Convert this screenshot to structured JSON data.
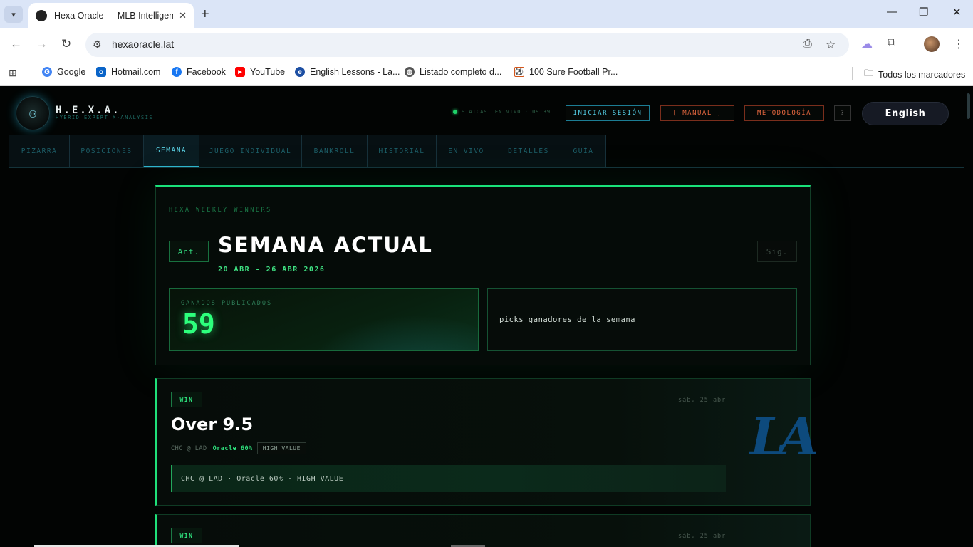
{
  "browser": {
    "tab_title": "Hexa Oracle — MLB Intelligence",
    "url": "hexaoracle.lat",
    "bookmarks": [
      {
        "label": "Google",
        "color": "#4285f4",
        "glyph": "G"
      },
      {
        "label": "Hotmail.com",
        "color": "#0a64c8",
        "glyph": "o"
      },
      {
        "label": "Facebook",
        "color": "#1877f2",
        "glyph": "f"
      },
      {
        "label": "YouTube",
        "color": "#ff0000",
        "glyph": "▶"
      },
      {
        "label": "English Lessons - La...",
        "color": "#1d4fa3",
        "glyph": "e"
      },
      {
        "label": "Listado completo d...",
        "color": "#555555",
        "glyph": "◍"
      },
      {
        "label": "100 Sure Football Pr...",
        "color": "#d4551a",
        "glyph": "⚽"
      }
    ],
    "all_bookmarks": "Todos los marcadores"
  },
  "header": {
    "brand": "H.E.X.A.",
    "brand_sub": "HYBRID EXPERT X-ANALYSIS",
    "live_status": "STATCAST EN VIVO · 09:39",
    "login": "INICIAR SESIÓN",
    "manual": "[ MANUAL ]",
    "methodology": "METODOLOGÍA",
    "help": "?",
    "language": "English"
  },
  "nav": {
    "tabs": [
      {
        "label": "PIZARRA",
        "active": false
      },
      {
        "label": "POSICIONES",
        "active": false
      },
      {
        "label": "SEMANA",
        "active": true
      },
      {
        "label": "JUEGO INDIVIDUAL",
        "active": false
      },
      {
        "label": "BANKROLL",
        "active": false
      },
      {
        "label": "HISTORIAL",
        "active": false
      },
      {
        "label": "EN VIVO",
        "active": false
      },
      {
        "label": "DETALLES",
        "active": false
      },
      {
        "label": "GUÍA",
        "active": false
      }
    ]
  },
  "hero": {
    "eyebrow": "HEXA WEEKLY WINNERS",
    "prev": "Ant.",
    "next": "Sig.",
    "title": "SEMANA ACTUAL",
    "range": "20 ABR - 26 ABR 2026",
    "stat_label": "GANADOS PUBLICADOS",
    "stat_value": "59",
    "info_text": "picks ganadores de la semana"
  },
  "picks": [
    {
      "badge": "WIN",
      "date": "sáb, 25 abr",
      "title": "Over 9.5",
      "matchup": "CHC @ LAD",
      "oracle": "Oracle 60%",
      "tag": "HIGH VALUE",
      "detail": "CHC @ LAD · Oracle 60% · HIGH VALUE",
      "team_logo": "LA"
    },
    {
      "badge": "WIN",
      "date": "sáb, 25 abr"
    }
  ],
  "colors": {
    "accent_green": "#1fe07a",
    "accent_cyan": "#55d2ea",
    "accent_orange": "#e4673f",
    "dodgers_blue": "#0d4a7d"
  }
}
